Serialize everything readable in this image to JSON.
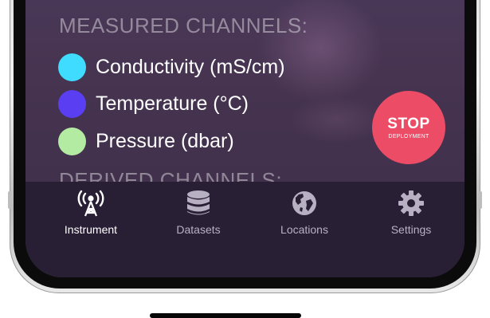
{
  "colors": {
    "screen_background": "#45334f",
    "tab_bar_background": "#291f35",
    "stop_button": "#ec4c66",
    "active_tab_text": "#ffffff",
    "inactive_tab_text": "#b7b0c2"
  },
  "measured": {
    "heading": "MEASURED CHANNELS:",
    "channels": [
      {
        "label": "Conductivity (mS/cm)",
        "color": "#3fdcff"
      },
      {
        "label": "Temperature (°C)",
        "color": "#5a3ff2"
      },
      {
        "label": "Pressure (dbar)",
        "color": "#b3eba2"
      }
    ]
  },
  "derived": {
    "heading": "DERIVED CHANNELS:"
  },
  "stop_button": {
    "title": "STOP",
    "subtitle": "DEPLOYMENT"
  },
  "tabs": [
    {
      "label": "Instrument",
      "icon": "broadcast-tower-icon",
      "active": true
    },
    {
      "label": "Datasets",
      "icon": "database-icon",
      "active": false
    },
    {
      "label": "Locations",
      "icon": "globe-icon",
      "active": false
    },
    {
      "label": "Settings",
      "icon": "gear-icon",
      "active": false
    }
  ]
}
